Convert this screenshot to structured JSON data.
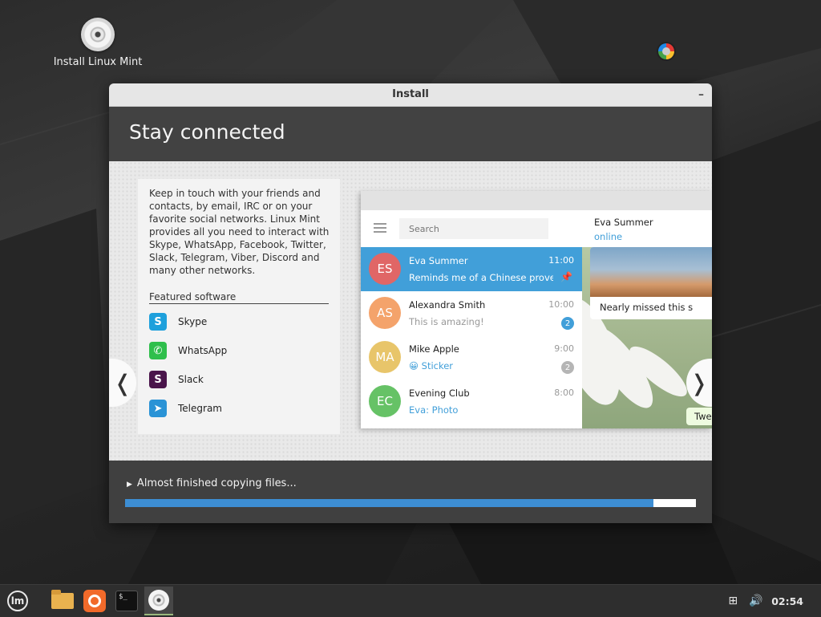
{
  "desktop": {
    "icon_label": "Install Linux Mint"
  },
  "window": {
    "title": "Install",
    "minimize": "–",
    "page_title": "Stay connected",
    "description": "Keep in touch with your friends and contacts, by email, IRC or on your favorite social networks. Linux Mint provides all you need to interact with Skype, WhatsApp, Facebook, Twitter, Slack, Telegram, Viber, Discord and many other networks.",
    "featured_heading": "Featured software",
    "software": [
      {
        "name": "Skype",
        "icon": "skype-icon",
        "color": "#1ea0dc",
        "glyph": "S"
      },
      {
        "name": "WhatsApp",
        "icon": "whatsapp-icon",
        "color": "#2fbf4c",
        "glyph": "✆"
      },
      {
        "name": "Slack",
        "icon": "slack-icon",
        "color": "#4a154b",
        "glyph": "S"
      },
      {
        "name": "Telegram",
        "icon": "telegram-icon",
        "color": "#2a93d6",
        "glyph": "➤"
      }
    ],
    "prev_arrow": "❬",
    "next_arrow": "❭",
    "status_text": "Almost finished copying files...",
    "progress": 0.926
  },
  "telegram": {
    "search_placeholder": "Search",
    "chats": [
      {
        "initials": "ES",
        "name": "Eva Summer",
        "time": "11:00",
        "message": "Reminds me of a Chinese prover…",
        "avatar_color": "#e06666",
        "active": true,
        "pinned": true
      },
      {
        "initials": "AS",
        "name": "Alexandra Smith",
        "time": "10:00",
        "message": "This is amazing!",
        "avatar_color": "#f4a36b",
        "badge": "2",
        "badge_color": "#419fd9"
      },
      {
        "initials": "MA",
        "name": "Mike Apple",
        "time": "9:00",
        "message": "😀 Sticker",
        "avatar_color": "#e8c56a",
        "badge": "2",
        "badge_color": "#b5b5b5"
      },
      {
        "initials": "EC",
        "name": "Evening Club",
        "time": "8:00",
        "message": "Eva: Photo",
        "avatar_color": "#66c266"
      }
    ],
    "conversation": {
      "name": "Eva Summer",
      "status": "online",
      "photo_caption": "Nearly missed this s",
      "reply_preview": "Twe"
    }
  },
  "taskbar": {
    "clock": "02:54",
    "menu_glyph": "lm",
    "terminal_glyph": "$_"
  },
  "colors": {
    "accent": "#3d8ed4",
    "telegram_blue": "#419fd9",
    "window_dark": "#404040"
  }
}
